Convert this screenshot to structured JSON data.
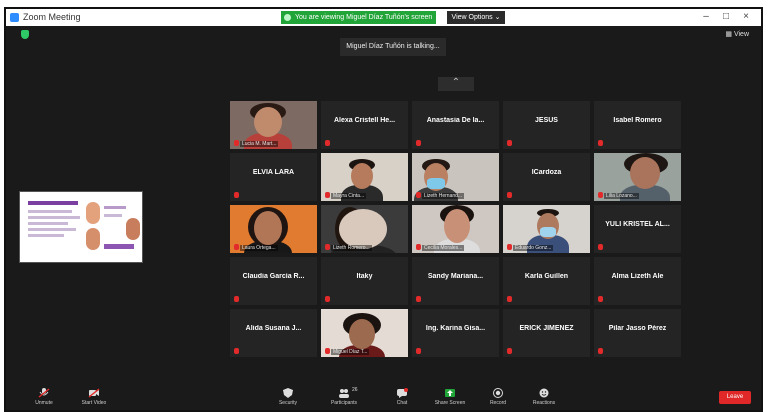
{
  "window": {
    "title": "Zoom Meeting",
    "minimize": "–",
    "maximize": "□",
    "close": "×"
  },
  "share_banner": "You are viewing Miguel Díaz Tuñón's screen",
  "view_options": "View Options ⌄",
  "view_button": "View",
  "toast": "Miguel Díaz Tuñón is talking...",
  "pager_up": "⌃",
  "tiles": [
    {
      "name": "",
      "label": "Lucia M. Mart..."
    },
    {
      "name": "Alexa Cristell He...",
      "label": ""
    },
    {
      "name": "Anastasia De la...",
      "label": ""
    },
    {
      "name": "JESUS",
      "label": ""
    },
    {
      "name": "Isabel Romero",
      "label": ""
    },
    {
      "name": "ELVIA LARA",
      "label": ""
    },
    {
      "name": "",
      "label": "Mayra Cinta..."
    },
    {
      "name": "",
      "label": "Lizeth Hernand..."
    },
    {
      "name": "ICardoza",
      "label": ""
    },
    {
      "name": "",
      "label": "Lilia Lozano..."
    },
    {
      "name": "",
      "label": "Laura Ortega..."
    },
    {
      "name": "",
      "label": "Lizeth Romero..."
    },
    {
      "name": "",
      "label": "Cecilia Morales..."
    },
    {
      "name": "",
      "label": "Eduardo Gonz..."
    },
    {
      "name": "YULI KRISTEL AL...",
      "label": ""
    },
    {
      "name": "Claudia García R...",
      "label": ""
    },
    {
      "name": "Itaky",
      "label": ""
    },
    {
      "name": "Sandy Mariana...",
      "label": ""
    },
    {
      "name": "Karla Guillen",
      "label": ""
    },
    {
      "name": "Alma Lizeth Ale",
      "label": ""
    },
    {
      "name": "Alida Susana J...",
      "label": ""
    },
    {
      "name": "",
      "label": "Miguel Díaz T..."
    },
    {
      "name": "Ing. Karina Gisa...",
      "label": ""
    },
    {
      "name": "ERICK JIMENEZ",
      "label": ""
    },
    {
      "name": "Pilar Jasso Pérez",
      "label": ""
    }
  ],
  "toolbar": {
    "unmute": "Unmute",
    "start_video": "Start Video",
    "security": "Security",
    "participants": "Participants",
    "participants_count": "26",
    "chat": "Chat",
    "share_screen": "Share Screen",
    "record": "Record",
    "reactions": "Reactions",
    "end": "Leave"
  },
  "colors": {
    "end_button": "#e02828",
    "share_banner": "#21a438",
    "mic_muted": "#e22a2a"
  }
}
